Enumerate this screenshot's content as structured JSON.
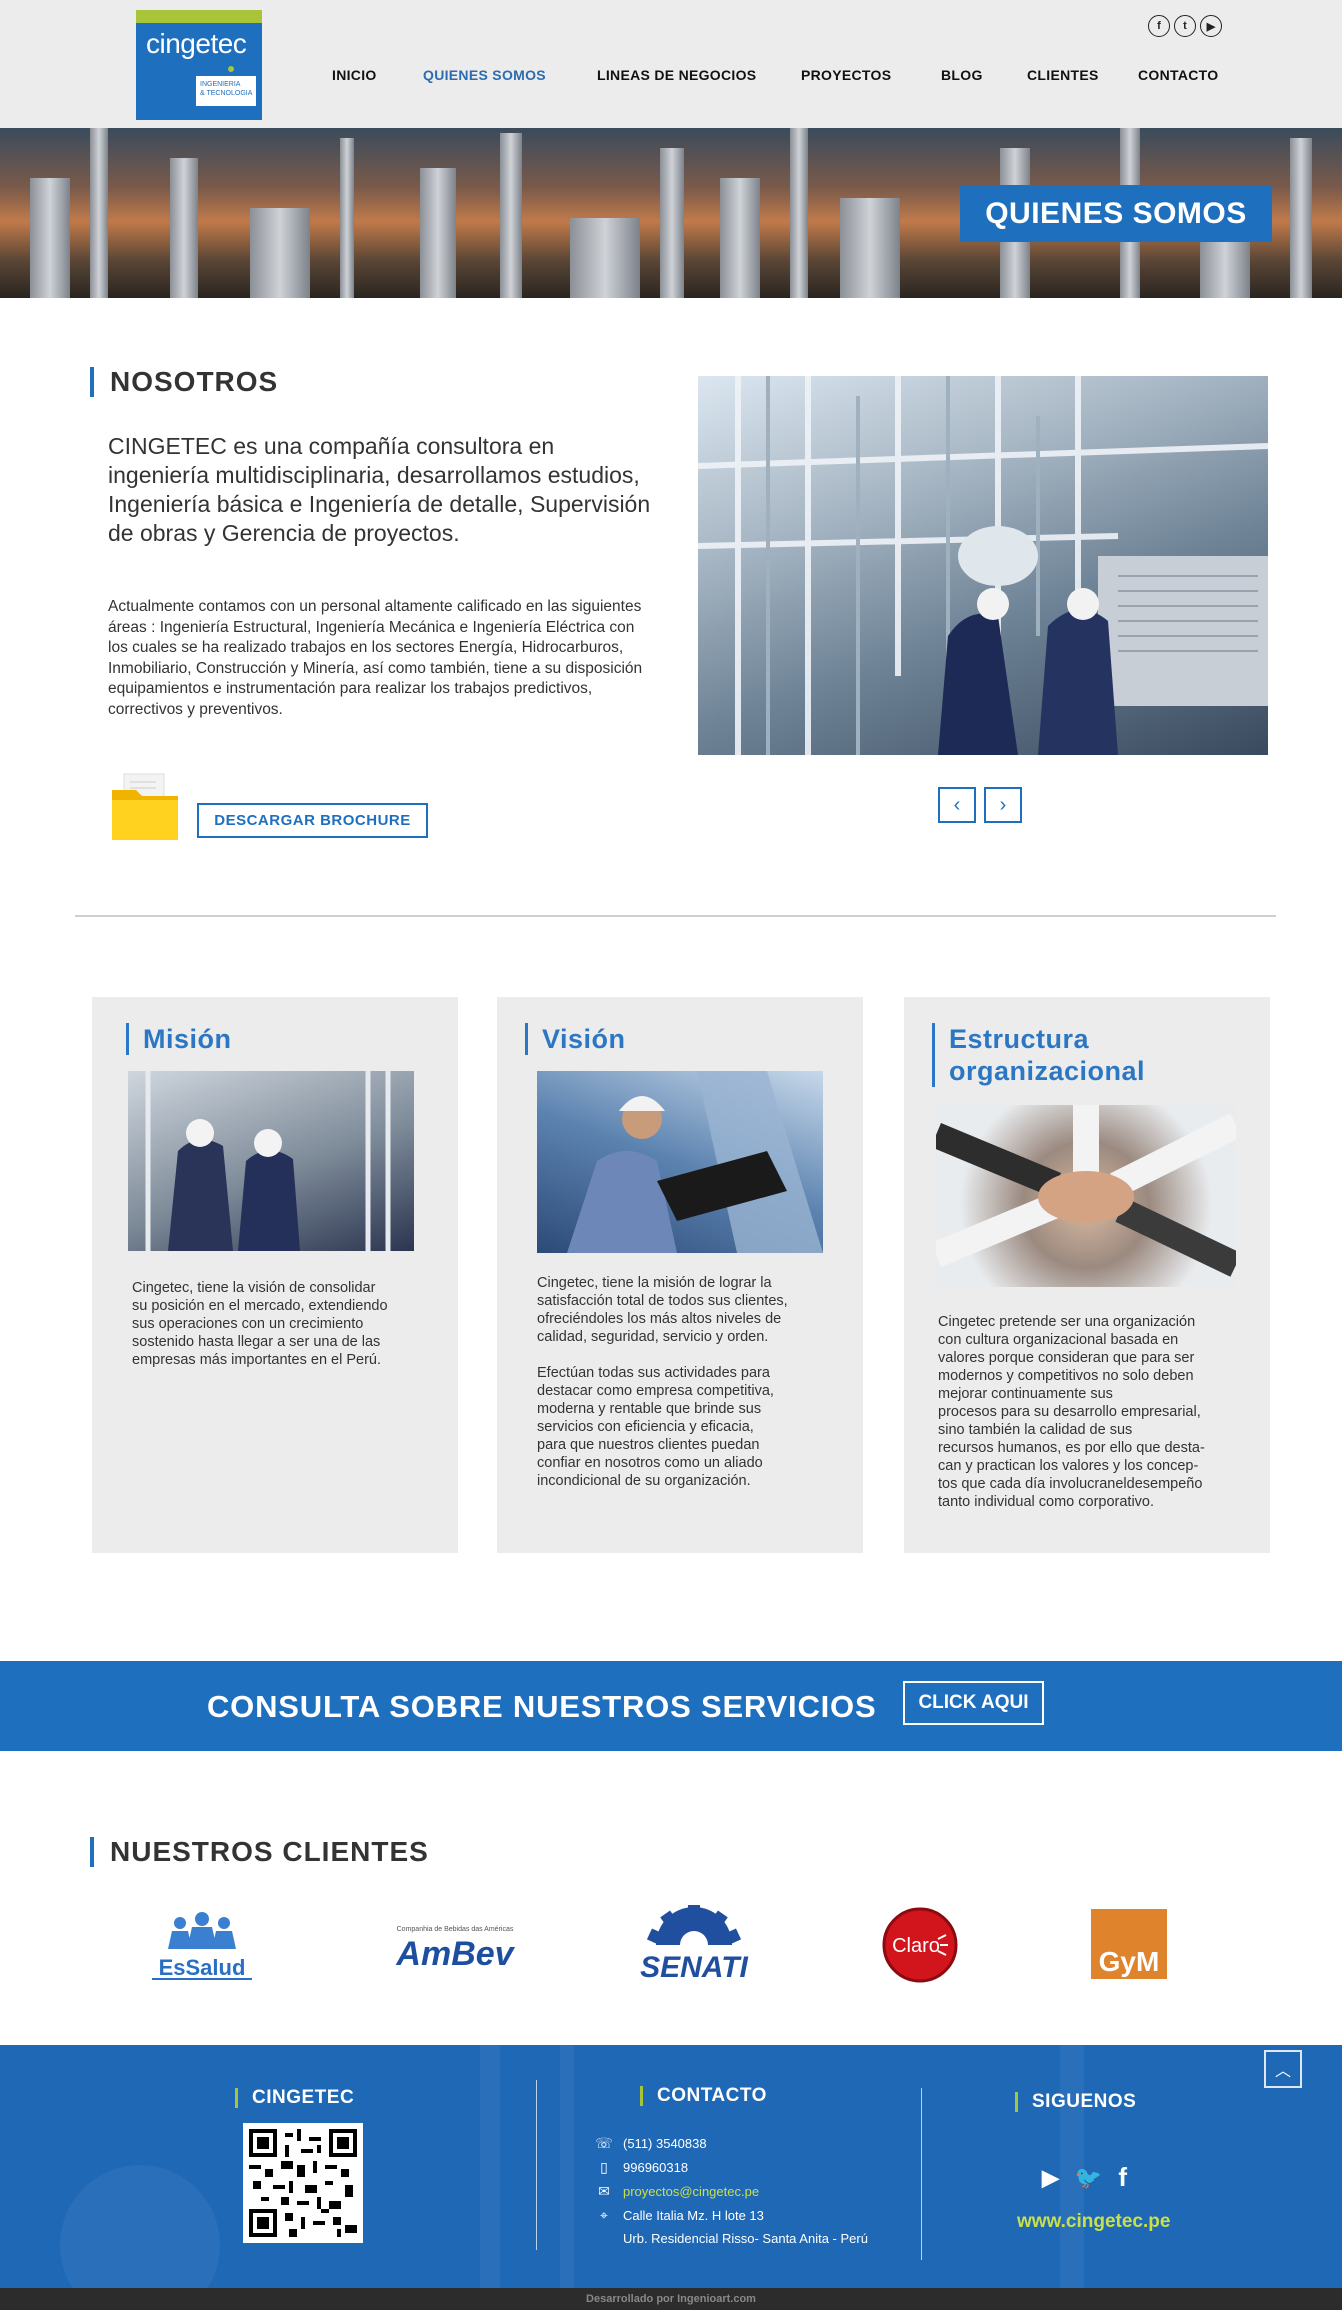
{
  "header": {
    "logo": {
      "name": "cingetec",
      "tagline_1": "INGENIERIA",
      "tagline_2": "& TECNOLOGIA"
    },
    "social": [
      {
        "icon": "facebook-icon",
        "glyph": "f"
      },
      {
        "icon": "twitter-icon",
        "glyph": "t"
      },
      {
        "icon": "youtube-icon",
        "glyph": "▶"
      }
    ],
    "nav": [
      {
        "label": "INICIO",
        "active": false
      },
      {
        "label": "QUIENES SOMOS",
        "active": true
      },
      {
        "label": "LINEAS DE NEGOCIOS",
        "active": false
      },
      {
        "label": "PROYECTOS",
        "active": false
      },
      {
        "label": "BLOG",
        "active": false
      },
      {
        "label": "CLIENTES",
        "active": false
      },
      {
        "label": "CONTACTO",
        "active": false
      }
    ]
  },
  "hero": {
    "badge": "QUIENES SOMOS"
  },
  "nosotros": {
    "title": "NOSOTROS",
    "lead": "CINGETEC es una compañía consultora en ingeniería multidisciplinaria, desarrollamos estudios, Ingeniería básica e Ingeniería de detalle, Supervisión de obras y Gerencia de proyectos.",
    "body": "Actualmente contamos con un personal altamente calificado en las siguientes áreas : Ingeniería Estructural, Ingeniería Mecánica e Ingeniería Eléctrica con los cuales se ha realizado trabajos en los sectores Energía, Hidrocarburos, Inmobiliario, Construcción y Minería, así como también, tiene a su disposición equipamientos e instrumentación para realizar los trabajos predictivos, correctivos y preventivos.",
    "brochure_label": "DESCARGAR BROCHURE",
    "prev": "‹",
    "next": "›"
  },
  "cards": [
    {
      "title": "Misión",
      "text": "Cingetec, tiene la visión de consolidar\nsu posición en el mercado, extendiendo\nsus operaciones con un crecimiento\nsostenido hasta llegar a ser una de las\nempresas más importantes en el Perú."
    },
    {
      "title": "Visión",
      "text": "Cingetec, tiene la misión de lograr la\nsatisfacción total de todos sus clientes,\nofreciéndoles los más altos niveles de\ncalidad, seguridad, servicio y orden.\n\nEfectúan todas sus actividades para\ndestacar como empresa competitiva,\nmoderna y rentable que brinde sus\nservicios con eficiencia y eficacia,\npara que nuestros clientes puedan\nconfiar en nosotros como un aliado\nincondicional de su organización."
    },
    {
      "title_1": "Estructura",
      "title_2": "organizacional",
      "text": "Cingetec pretende ser una organización\ncon cultura organizacional basada en\nvalores porque consideran que para ser\nmodernos y competitivos no solo deben\nmejorar continuamente sus\nprocesos para su desarrollo empresarial,\nsino también la calidad de sus\nrecursos humanos, es por ello que desta-\ncan y practican los valores y los concep-\ntos que cada día involucraneldesempeño\ntanto individual como corporativo."
    }
  ],
  "banner": {
    "text": "CONSULTA SOBRE NUESTROS SERVICIOS",
    "button": "CLICK AQUI"
  },
  "clientes": {
    "title": "NUESTROS CLIENTES",
    "logos": [
      {
        "name": "EsSalud"
      },
      {
        "name": "AmBev",
        "sub": "Companhia de Bebidas das Américas"
      },
      {
        "name": "SENATI"
      },
      {
        "name": "Claro"
      },
      {
        "name": "GyM"
      }
    ]
  },
  "footer": {
    "col1_title": "CINGETEC",
    "col2_title": "CONTACTO",
    "col3_title": "SIGUENOS",
    "contact": [
      {
        "icon": "phone-icon",
        "glyph": "☏",
        "text": "(511) 3540838"
      },
      {
        "icon": "mobile-icon",
        "glyph": "▯",
        "text": "996960318"
      },
      {
        "icon": "mail-icon",
        "glyph": "✉",
        "text": "proyectos@cingetec.pe"
      },
      {
        "icon": "location-icon",
        "glyph": "⌖",
        "text": "Calle Italia Mz. H lote 13"
      },
      {
        "icon": "",
        "glyph": "",
        "text": "Urb. Residencial Risso- Santa Anita - Perú"
      }
    ],
    "follow": [
      {
        "icon": "youtube-icon",
        "glyph": "▶"
      },
      {
        "icon": "twitter-icon",
        "glyph": "🐦"
      },
      {
        "icon": "facebook-icon",
        "glyph": "f"
      }
    ],
    "website": "www.cingetec.pe",
    "up": "︿",
    "credit": "Desarrollado por Ingenioart.com"
  },
  "colors": {
    "brand_blue": "#1f6fbf",
    "accent_green": "#a8c53a",
    "card_bg": "#ececec"
  }
}
